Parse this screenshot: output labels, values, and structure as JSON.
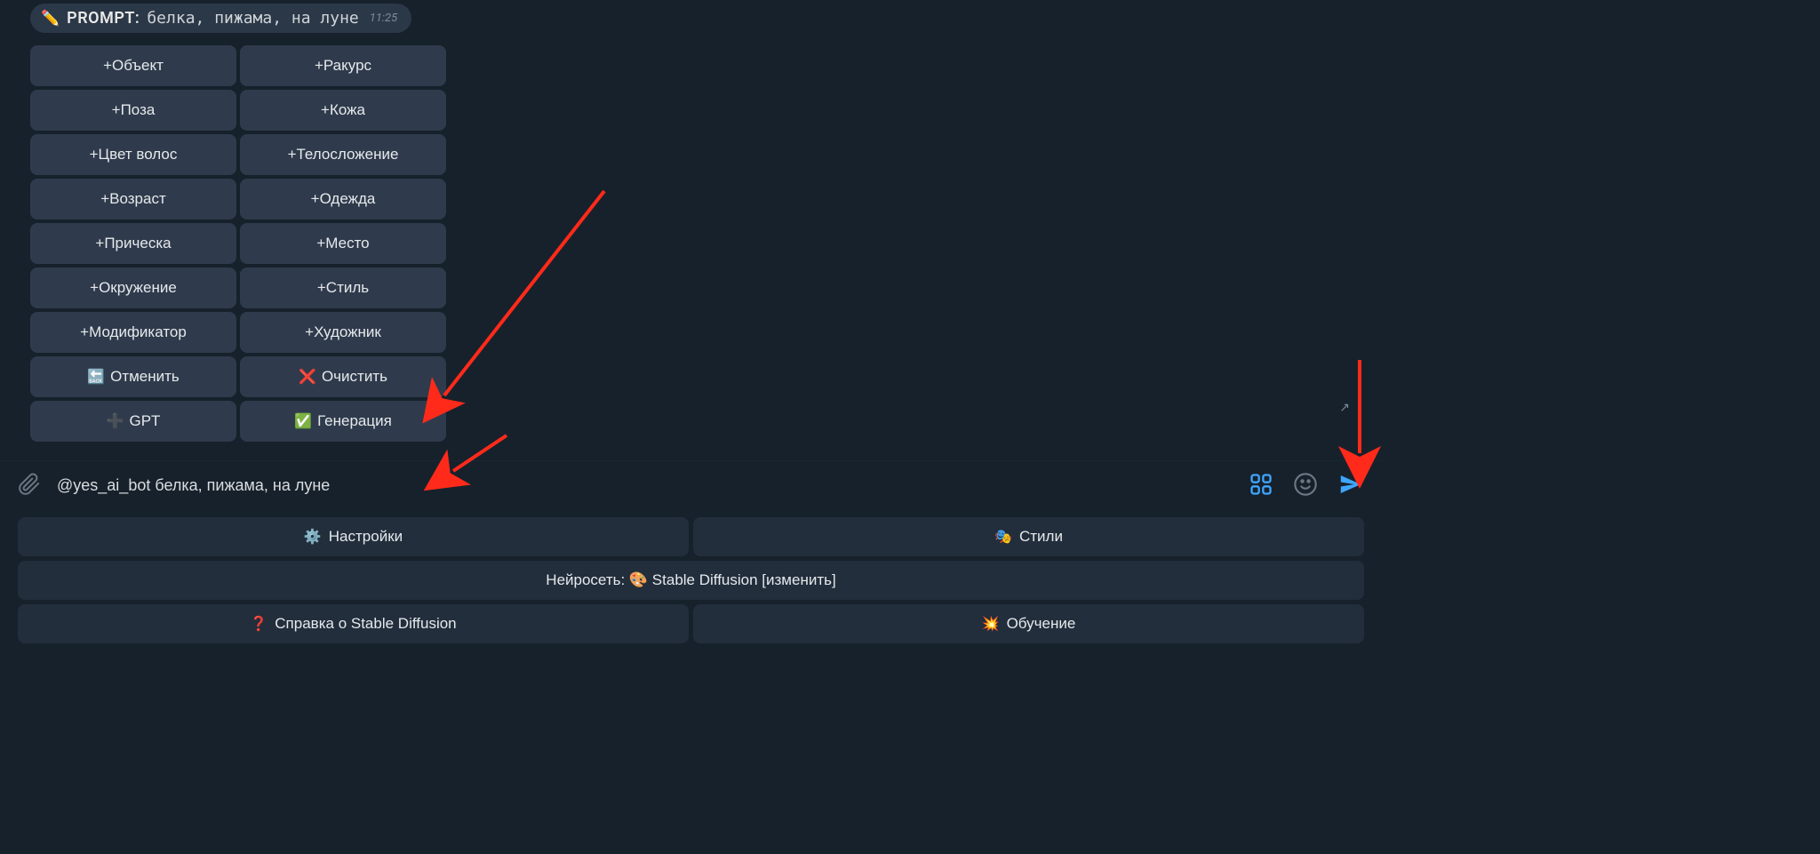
{
  "prompt_bubble": {
    "icon": "✏️",
    "label": "PROMPT:",
    "text": "белка, пижама, на луне",
    "time": "11:25"
  },
  "inline_buttons": [
    [
      {
        "label": "+Объект"
      },
      {
        "label": "+Ракурс"
      }
    ],
    [
      {
        "label": "+Поза"
      },
      {
        "label": "+Кожа"
      }
    ],
    [
      {
        "label": "+Цвет волос"
      },
      {
        "label": "+Телосложение"
      }
    ],
    [
      {
        "label": "+Возраст"
      },
      {
        "label": "+Одежда"
      }
    ],
    [
      {
        "label": "+Прическа"
      },
      {
        "label": "+Место"
      }
    ],
    [
      {
        "label": "+Окружение"
      },
      {
        "label": "+Стиль"
      }
    ],
    [
      {
        "label": "+Модификатор"
      },
      {
        "label": "+Художник"
      }
    ],
    [
      {
        "icon": "🔙",
        "label": "Отменить"
      },
      {
        "icon": "❌",
        "label": "Очистить"
      }
    ],
    [
      {
        "icon": "➕",
        "label": "GPT",
        "muted_icon": true
      },
      {
        "icon": "✅",
        "label": "Генерация"
      }
    ]
  ],
  "share_glyph": "↗",
  "input": {
    "value": "@yes_ai_bot белка, пижама, на луне"
  },
  "bottom_keyboard": {
    "row1": [
      {
        "icon": "⚙️",
        "label": "Настройки"
      },
      {
        "icon": "🎭",
        "label": "Стили"
      }
    ],
    "row2_full": {
      "label": "Нейросеть: 🎨 Stable Diffusion [изменить]"
    },
    "row3": [
      {
        "icon": "❓",
        "label": "Справка о Stable Diffusion",
        "icon_color": "#ff4d4d"
      },
      {
        "icon": "💥",
        "label": "Обучение"
      }
    ]
  }
}
